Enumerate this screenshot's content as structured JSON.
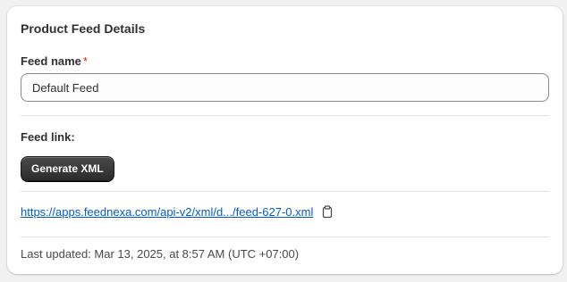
{
  "card": {
    "title": "Product Feed Details"
  },
  "feed_name": {
    "label": "Feed name",
    "required_marker": "*",
    "value": "Default Feed"
  },
  "feed_link": {
    "label": "Feed link:",
    "generate_button": "Generate XML",
    "url": "https://apps.feednexa.com/api-v2/xml/d.../feed-627-0.xml",
    "copy_icon": "clipboard-icon"
  },
  "last_updated": "Last updated: Mar 13, 2025, at 8:57 AM (UTC +07:00)",
  "colors": {
    "link": "#005bd3",
    "required": "#e51c00",
    "button_bg": "#303030"
  }
}
